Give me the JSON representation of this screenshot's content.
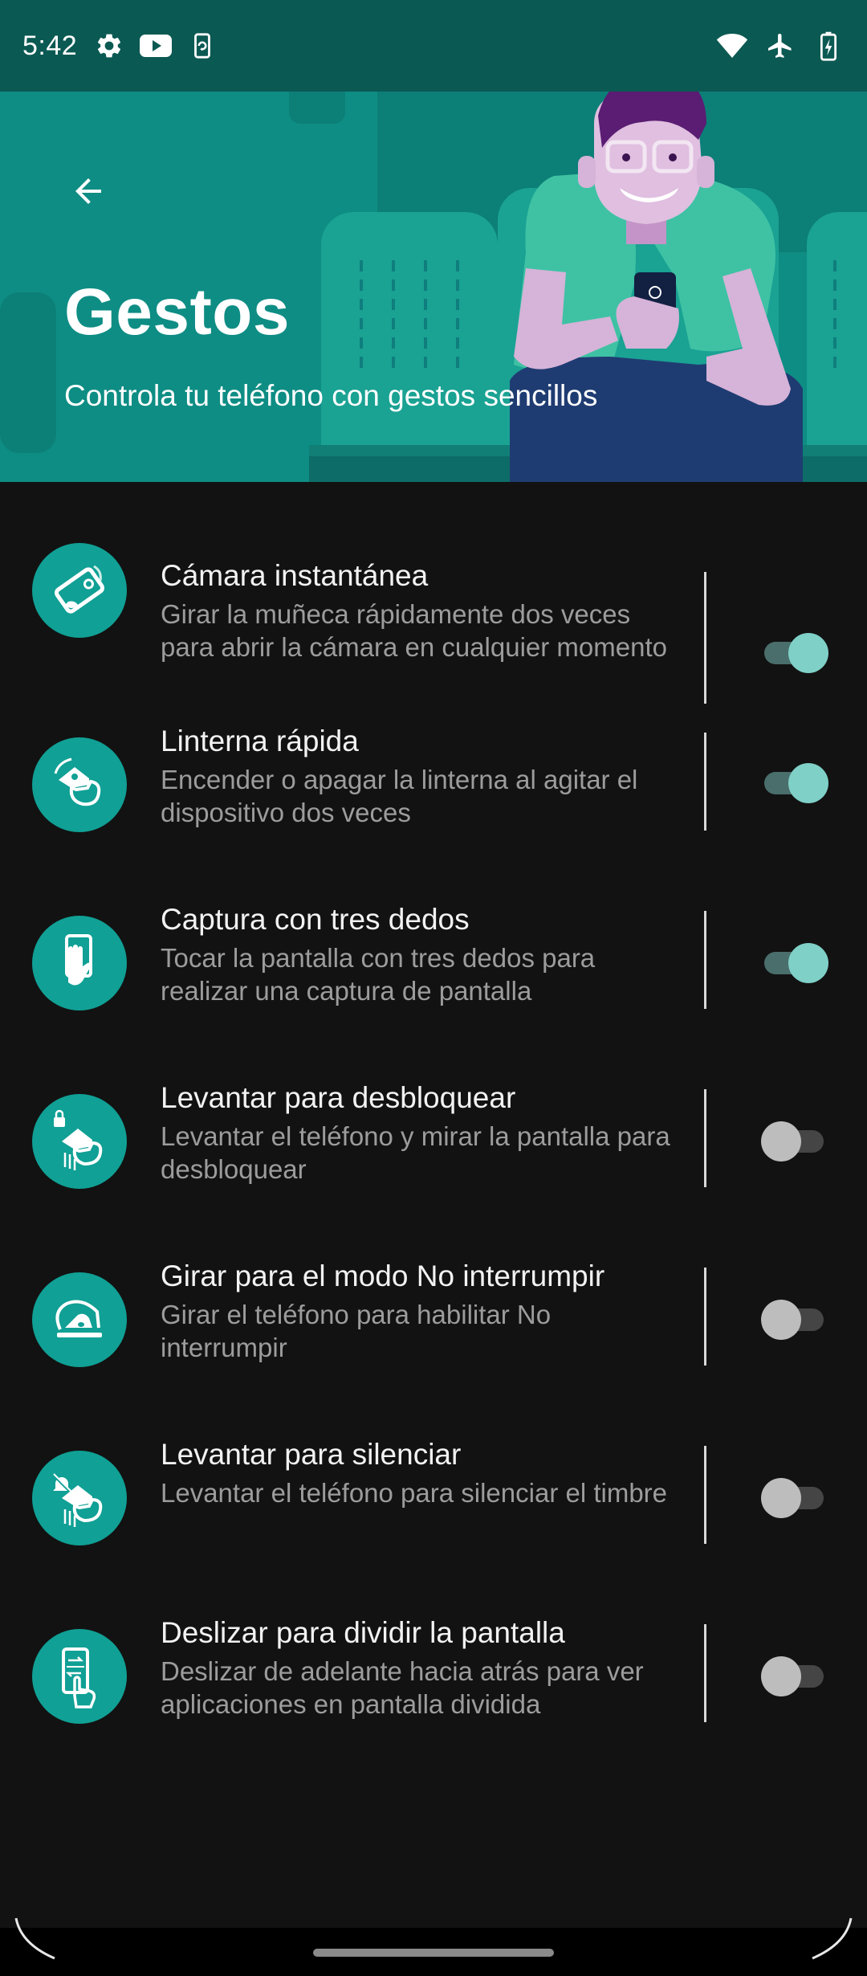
{
  "status_bar": {
    "time": "5:42",
    "left_icons": [
      "settings-gear-icon",
      "youtube-icon",
      "screen-rotate-icon"
    ],
    "right_icons": [
      "wifi-icon",
      "airplane-mode-icon",
      "battery-charging-icon"
    ]
  },
  "header": {
    "title": "Gestos",
    "subtitle": "Controla tu teléfono con gestos sencillos",
    "back_icon": "arrow-back-icon"
  },
  "gestures": [
    {
      "title": "Cámara instantánea",
      "description": "Girar la muñeca rápidamente dos veces para abrir la cámara en cualquier momento",
      "icon": "wrist-twist-camera-icon",
      "enabled": true
    },
    {
      "title": "Linterna rápida",
      "description": "Encender o apagar la linterna al agitar el dispositivo dos veces",
      "icon": "chop-flashlight-icon",
      "enabled": true
    },
    {
      "title": "Captura con tres dedos",
      "description": "Tocar la pantalla con tres dedos para realizar una captura de pantalla",
      "icon": "three-finger-screenshot-icon",
      "enabled": true
    },
    {
      "title": "Levantar para desbloquear",
      "description": "Levantar el teléfono y mirar la pantalla para desbloquear",
      "icon": "lift-unlock-icon",
      "enabled": false
    },
    {
      "title": "Girar para el modo No interrumpir",
      "description": "Girar el teléfono para habilitar No interrumpir",
      "icon": "flip-dnd-icon",
      "enabled": false
    },
    {
      "title": "Levantar para silenciar",
      "description": "Levantar el teléfono para silenciar el timbre",
      "icon": "lift-silence-icon",
      "enabled": false
    },
    {
      "title": "Deslizar para dividir la pantalla",
      "description": "Deslizar de adelante hacia atrás para ver aplicaciones en pantalla dividida",
      "icon": "swipe-split-screen-icon",
      "enabled": false
    }
  ],
  "colors": {
    "accent": "#10a095",
    "header_background": "#0e8d84",
    "status_bar_background": "#0b5953",
    "background": "#121212",
    "toggle_on_thumb": "#7fd0c7",
    "toggle_off_thumb": "#bdbdbd"
  }
}
